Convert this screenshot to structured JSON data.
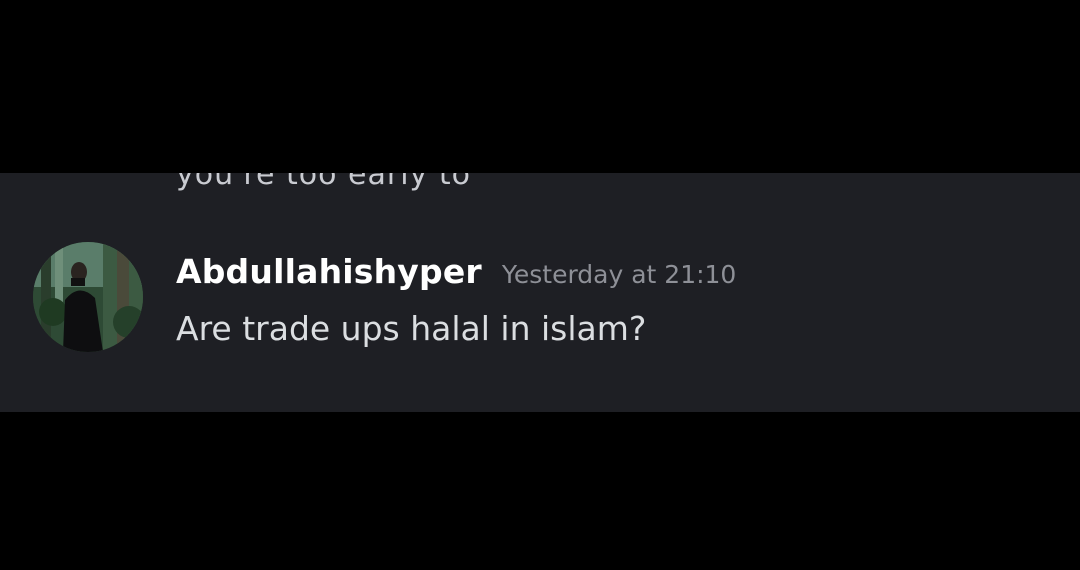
{
  "previous_message": {
    "partial_text": "you're too early to"
  },
  "message": {
    "avatar_icon": "user-avatar-photo",
    "username": "Abdullahishyper",
    "timestamp": "Yesterday at 21:10",
    "content": "Are trade ups halal in islam?"
  },
  "colors": {
    "background_outer": "#000000",
    "panel": "#1e1f24",
    "username": "#ffffff",
    "timestamp": "#8e9097",
    "content": "#dbdee1"
  }
}
